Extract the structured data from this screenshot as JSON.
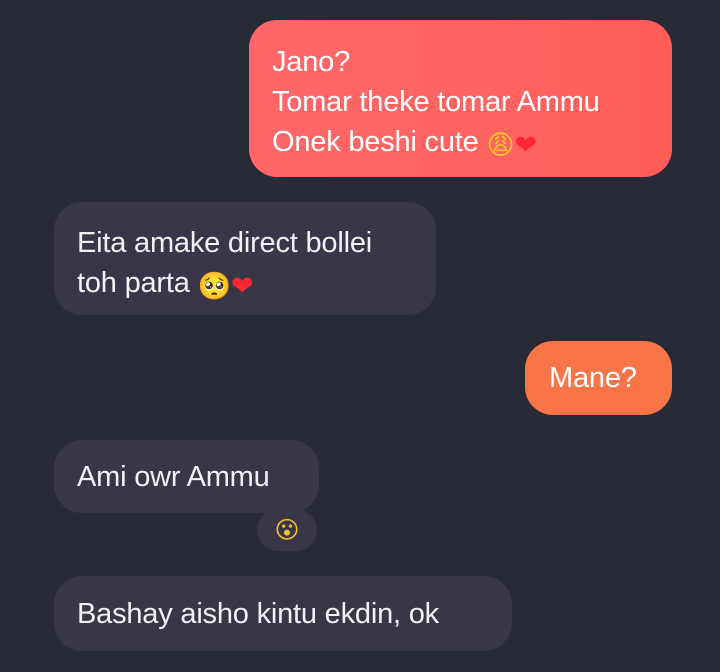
{
  "conversation": {
    "messages": [
      {
        "side": "outgoing",
        "lines": [
          "Jano?",
          "Tomar theke tomar Ammu",
          "Onek beshi cute"
        ],
        "emojis": [
          "😩",
          "❤"
        ]
      },
      {
        "side": "incoming",
        "lines": [
          "Eita amake direct bollei",
          "toh parta"
        ],
        "emojis": [
          "🥺",
          "❤"
        ]
      },
      {
        "side": "outgoing",
        "lines": [
          "Mane?"
        ]
      },
      {
        "side": "incoming",
        "lines": [
          "Ami owr Ammu"
        ],
        "reaction": "😮"
      },
      {
        "side": "incoming",
        "lines": [
          "Bashay aisho kintu ekdin, ok"
        ]
      }
    ]
  },
  "colors": {
    "background": "#282a36",
    "incoming_bubble": "#393647",
    "outgoing_bubble_red": "#ff6461",
    "outgoing_bubble_orange": "#f97547"
  },
  "icons": {
    "weary_face": "weary-face-icon",
    "heart": "red-heart-icon",
    "pleading_face": "pleading-face-icon",
    "surprised_face": "surprised-face-icon"
  }
}
